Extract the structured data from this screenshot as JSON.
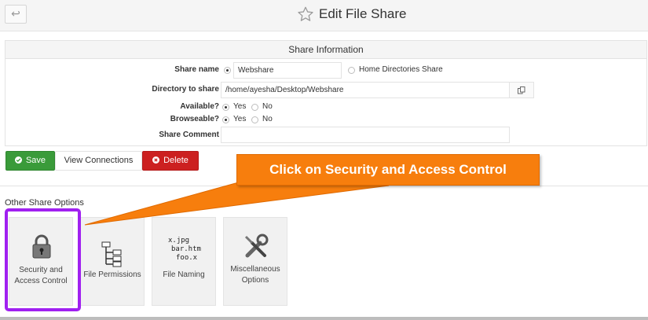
{
  "header": {
    "back_glyph": "↩",
    "title": "Edit File Share"
  },
  "panel": {
    "title": "Share Information",
    "share_name": {
      "label": "Share name",
      "value": "Webshare",
      "alt_option": "Home Directories Share"
    },
    "directory": {
      "label": "Directory to share",
      "value": "/home/ayesha/Desktop/Webshare"
    },
    "available": {
      "label": "Available?",
      "yes": "Yes",
      "no": "No",
      "selected": "Yes"
    },
    "browseable": {
      "label": "Browseable?",
      "yes": "Yes",
      "no": "No",
      "selected": "Yes"
    },
    "comment": {
      "label": "Share Comment",
      "value": ""
    }
  },
  "actions": {
    "save": "Save",
    "view_connections": "View Connections",
    "delete": "Delete"
  },
  "options": {
    "title": "Other Share Options",
    "tiles": [
      {
        "label": "Security and Access Control",
        "icon": "padlock-icon"
      },
      {
        "label": "File Permissions",
        "icon": "file-tree-icon"
      },
      {
        "label": "File Naming",
        "icon": "file-names-icon"
      },
      {
        "label": "Miscellaneous Options",
        "icon": "tools-icon"
      }
    ],
    "file_naming_icon_text": [
      "x.jpg",
      "bar.htm",
      "foo.x"
    ]
  },
  "annotation": {
    "callout": "Click on Security and Access Control",
    "callout_color": "#f77e0d",
    "highlight_color": "#a020f0"
  },
  "colors": {
    "save": "#3a9b3a",
    "delete": "#cc2020"
  }
}
